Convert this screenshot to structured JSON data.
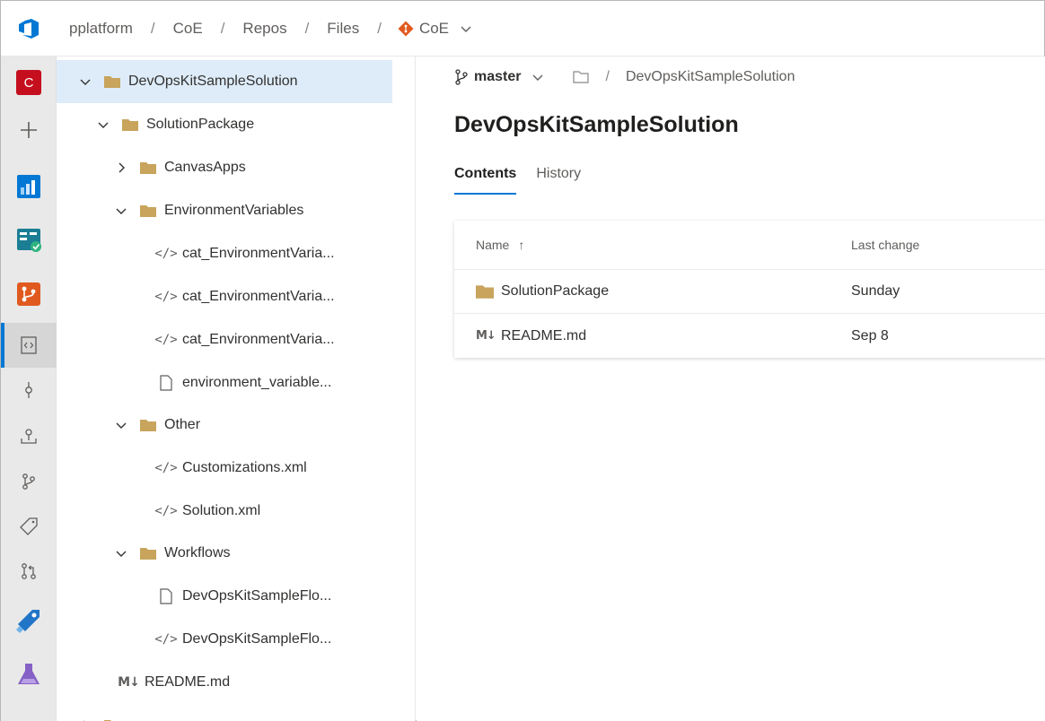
{
  "breadcrumbs": {
    "org": "pplatform",
    "project": "CoE",
    "section": "Repos",
    "subsection": "Files",
    "repo": "CoE",
    "separator": "/"
  },
  "rail": {
    "project_initial": "C",
    "colors": {
      "project": "#c50f1f",
      "boards": "#0078d4",
      "pipelines": "#1b7e95",
      "repos": "#e05a1f",
      "artifacts": "#2176c7",
      "testplans": "#8661c5"
    }
  },
  "tree": {
    "items": [
      {
        "label": "DevOpsKitSampleSolution",
        "type": "folder",
        "expanded": true,
        "selected": true
      },
      {
        "label": "SolutionPackage",
        "type": "folder",
        "expanded": true
      },
      {
        "label": "CanvasApps",
        "type": "folder",
        "expanded": false
      },
      {
        "label": "EnvironmentVariables",
        "type": "folder",
        "expanded": true
      },
      {
        "label": "cat_EnvironmentVaria...",
        "type": "code"
      },
      {
        "label": "cat_EnvironmentVaria...",
        "type": "code"
      },
      {
        "label": "cat_EnvironmentVaria...",
        "type": "code"
      },
      {
        "label": "environment_variable...",
        "type": "file"
      },
      {
        "label": "Other",
        "type": "folder",
        "expanded": true
      },
      {
        "label": "Customizations.xml",
        "type": "code"
      },
      {
        "label": "Solution.xml",
        "type": "code"
      },
      {
        "label": "Workflows",
        "type": "folder",
        "expanded": true
      },
      {
        "label": "DevOpsKitSampleFlo...",
        "type": "file"
      },
      {
        "label": "DevOpsKitSampleFlo...",
        "type": "code"
      },
      {
        "label": "README.md",
        "type": "markdown"
      }
    ]
  },
  "main": {
    "branch": "master",
    "path_sep": "/",
    "path": "DevOpsKitSampleSolution",
    "title": "DevOpsKitSampleSolution",
    "tabs": [
      {
        "label": "Contents",
        "active": true
      },
      {
        "label": "History",
        "active": false
      }
    ],
    "table": {
      "columns": {
        "name": "Name",
        "last_change": "Last change"
      },
      "rows": [
        {
          "name": "SolutionPackage",
          "type": "folder",
          "last_change": "Sunday"
        },
        {
          "name": "README.md",
          "type": "markdown",
          "last_change": "Sep 8"
        }
      ]
    }
  },
  "colors": {
    "accent": "#0078d4",
    "folder": "#c8a45c",
    "selected_row": "#deecf9"
  },
  "glyphs": {
    "code": "</>",
    "markdown": "M↓",
    "sort_up": "↑"
  }
}
